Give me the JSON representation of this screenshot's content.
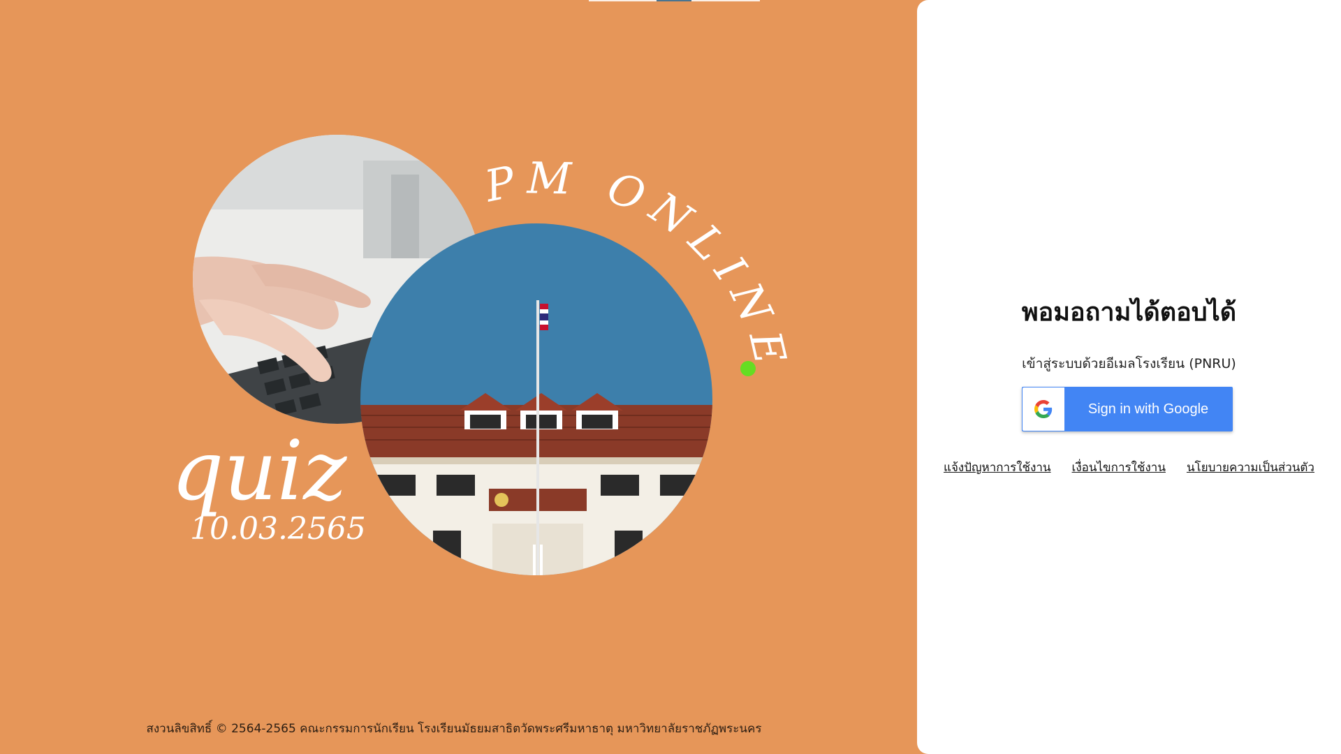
{
  "hero": {
    "brand_text": "PM ONLINE",
    "quiz_word": "quiz",
    "quiz_date": "10.03.2565",
    "building_sign": "โรงเรียนมัธยมสาธิตวัดพระศรีมหาธาตุ"
  },
  "login": {
    "title": "พอมอถามได้ตอบได้",
    "subtitle": "เข้าสู่ระบบด้วยอีเมลโรงเรียน (PNRU)",
    "google_button_label": "Sign in with Google"
  },
  "links": {
    "report": "แจ้งปัญหาการใช้งาน",
    "terms": "เงื่อนไขการใช้งาน",
    "privacy": "นโยบายความเป็นส่วนตัว"
  },
  "footer": {
    "text": "สงวนลิขสิทธิ์ © 2564-2565 คณะกรรมการนักเรียน โรงเรียนมัธยมสาธิตวัดพระศรีมหาธาตุ มหาวิทยาลัยราชภัฏพระนคร"
  },
  "colors": {
    "background": "#e69659",
    "sky": "#3d7fab",
    "google_blue": "#4285f4",
    "dot_green": "#66dd22"
  },
  "icons": [
    "google-g-icon",
    "green-dot-icon"
  ]
}
